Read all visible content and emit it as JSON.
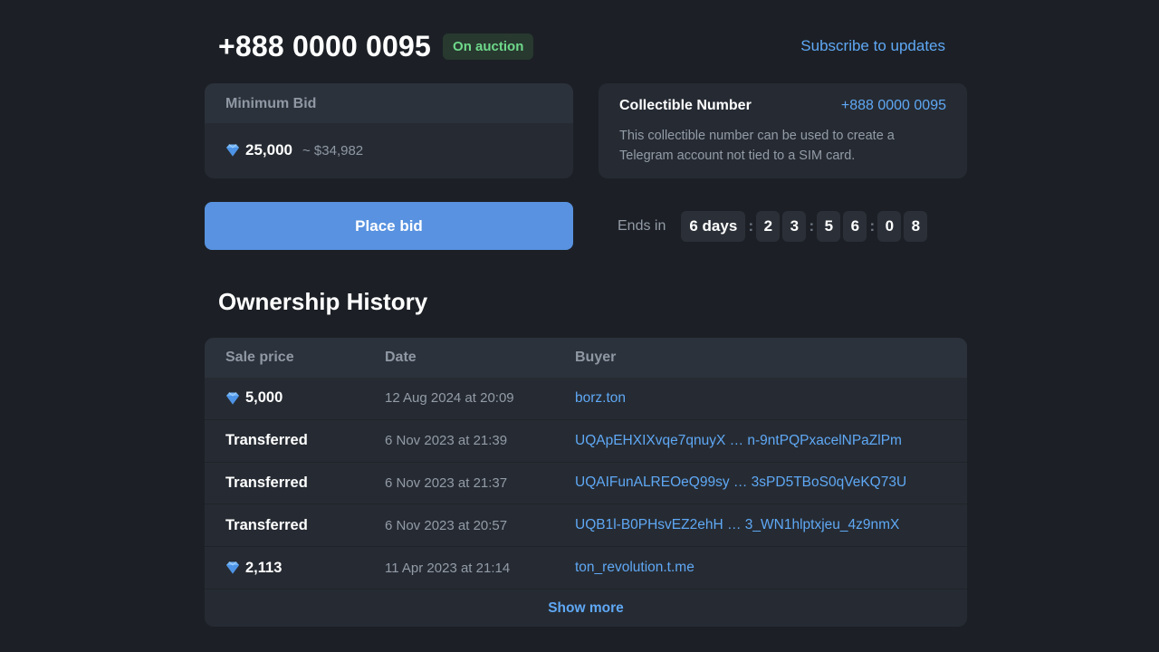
{
  "header": {
    "number": "+888 0000 0095",
    "status": "On auction",
    "subscribe_label": "Subscribe to updates"
  },
  "bid_card": {
    "title": "Minimum Bid",
    "amount": "25,000",
    "usd": "~ $34,982",
    "currency_icon": "ton-diamond-icon"
  },
  "info_card": {
    "title": "Collectible Number",
    "number": "+888 0000 0095",
    "description": "This collectible number can be used to create a Telegram account not tied to a SIM card."
  },
  "place_bid_label": "Place bid",
  "countdown": {
    "label": "Ends in",
    "days": "6 days",
    "hours": [
      "2",
      "3"
    ],
    "minutes": [
      "5",
      "6"
    ],
    "seconds": [
      "0",
      "8"
    ]
  },
  "history": {
    "title": "Ownership History",
    "columns": {
      "price": "Sale price",
      "date": "Date",
      "buyer": "Buyer"
    },
    "rows": [
      {
        "price": "5,000",
        "date": "12 Aug 2024 at 20:09",
        "buyer": "borz.ton"
      },
      {
        "price": "Transferred",
        "date": "6 Nov 2023 at 21:39",
        "buyer": "UQApEHXIXvqe7qnuyX … n-9ntPQPxacelNPaZlPm"
      },
      {
        "price": "Transferred",
        "date": "6 Nov 2023 at 21:37",
        "buyer": "UQAIFunALREOeQ99sy … 3sPD5TBoS0qVeKQ73U"
      },
      {
        "price": "Transferred",
        "date": "6 Nov 2023 at 20:57",
        "buyer": "UQB1l-B0PHsvEZ2ehH … 3_WN1hlptxjeu_4z9nmX"
      },
      {
        "price": "2,113",
        "date": "11 Apr 2023 at 21:14",
        "buyer": "ton_revolution.t.me"
      }
    ],
    "show_more_label": "Show more"
  },
  "colors": {
    "background": "#1c2026",
    "card": "#262b33",
    "accent": "#5fa8f5",
    "button": "#5892e0",
    "status_green": "#6ed98b"
  }
}
